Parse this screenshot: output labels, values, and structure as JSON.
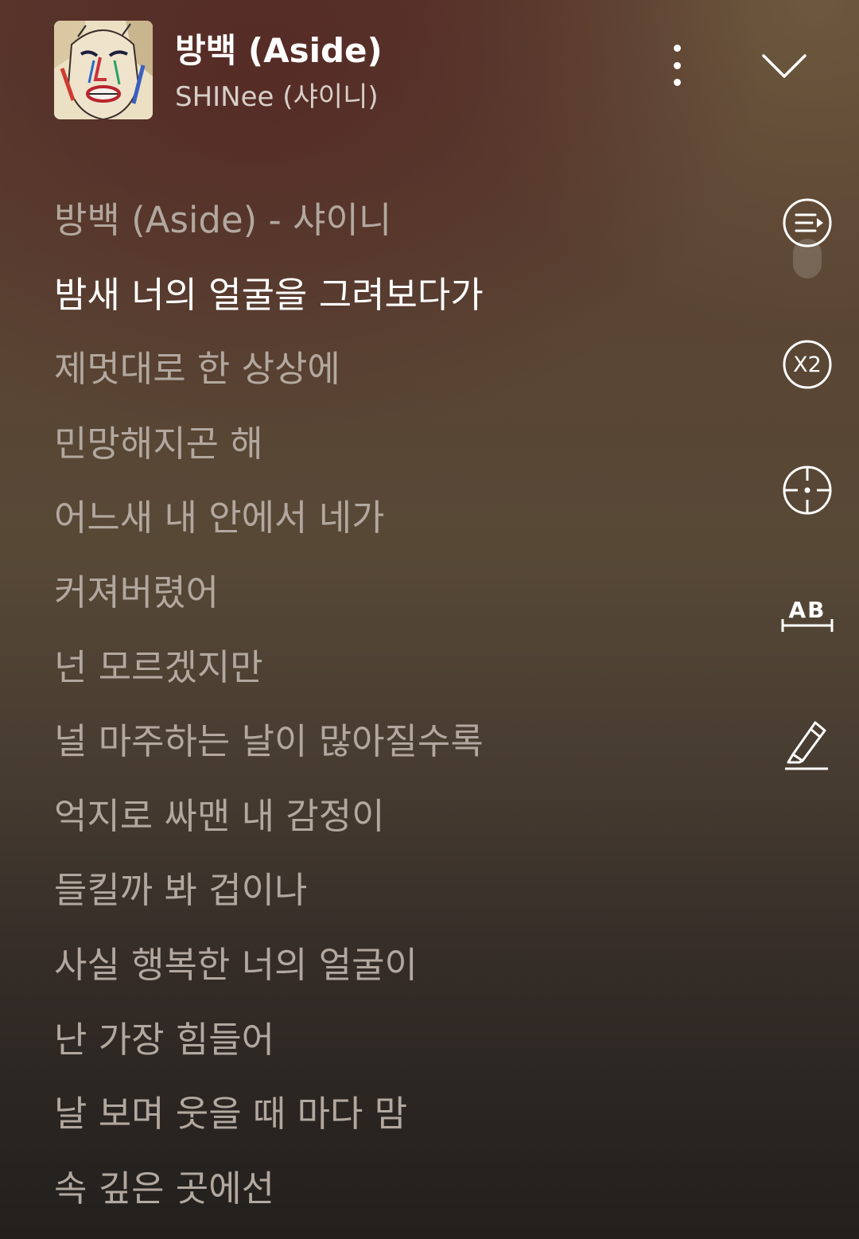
{
  "header": {
    "title": "방백 (Aside)",
    "artist": "SHINee (샤이니)",
    "more_icon": "more-vertical-icon",
    "collapse_icon": "chevron-down-icon"
  },
  "lyrics": {
    "current_index": 1,
    "lines": [
      "방백 (Aside) - 샤이니",
      "밤새 너의 얼굴을 그려보다가",
      "제멋대로 한 상상에",
      "민망해지곤 해",
      "어느새 내 안에서 네가",
      "커져버렸어",
      "넌 모르겠지만",
      "널 마주하는 날이 많아질수록",
      "억지로 싸맨 내 감정이",
      "들킬까 봐 겁이나",
      "사실 행복한 너의 얼굴이",
      "난 가장 힘들어",
      "날 보며 웃을 때 마다 맘",
      "속 깊은 곳에선"
    ]
  },
  "side_tools": {
    "lyrics_sync_icon": "lyrics-list-icon",
    "speed_label": "X2",
    "locate_icon": "crosshair-icon",
    "translate_label": "AB",
    "highlight_icon": "highlighter-icon"
  },
  "colors": {
    "current_line": "#ffffff",
    "other_line": "#b2a89f"
  }
}
